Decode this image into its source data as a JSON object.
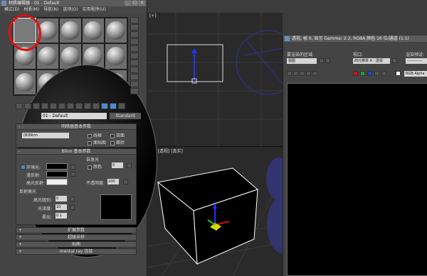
{
  "material_editor": {
    "title": "材质编辑器 - 01 - Default",
    "menu": [
      "模式(D)",
      "材质(M)",
      "导航(N)",
      "选项(O)",
      "实用程序(U)"
    ],
    "material_name": "01 - Default",
    "type_button": "Standard",
    "shader_rollout": {
      "title": "明暗器基本参数",
      "shader": "(B)Blinn",
      "options": [
        "线框",
        "双面",
        "面贴图",
        "面状"
      ]
    },
    "blinn_rollout": {
      "title": "Blinn 基本参数",
      "self_illum_title": "自发光",
      "color_label": "颜色",
      "color_value": "0",
      "ambient_label": "环境光:",
      "diffuse_label": "漫反射:",
      "specular_label": "高光反射:",
      "opacity_label": "不透明度:",
      "opacity_value": "100",
      "highlights_title": "反射高光",
      "spec_level_label": "高光级别:",
      "spec_level_value": "0",
      "gloss_label": "光泽度:",
      "gloss_value": "10",
      "soften_label": "柔化:",
      "soften_value": "0.1"
    },
    "collapsed_rollouts": [
      "扩展参数",
      "超级采样",
      "贴图",
      "mental ray 连接"
    ],
    "window_buttons": [
      "_",
      "□",
      "×"
    ]
  },
  "viewport": {
    "label": "[+] [透视] [真实]",
    "top_label": "[+]"
  },
  "render_window": {
    "title": "透视, 帧 0, 显示 Gamma: 2.2, RGBA 颜色 16 位/通道 (1:1)",
    "area_label": "要渲染的区域:",
    "area_value": "视图",
    "viewport_label": "视口:",
    "viewport_value": "四元菜单 4 - 透视",
    "preset_label": "渲染预设:",
    "preset_value": "------------",
    "channel_value": "RGB Alpha"
  },
  "colors": {
    "selection_circle": "#e01010",
    "accent_blue": "#4d8ad1"
  }
}
